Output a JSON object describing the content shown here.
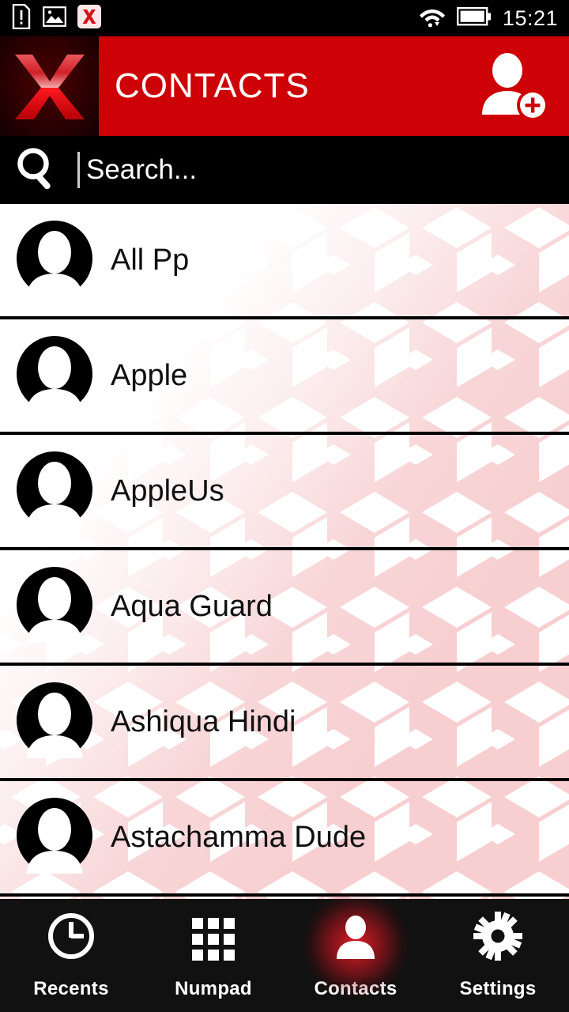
{
  "statusbar": {
    "icons": [
      {
        "name": "alert-document-icon",
        "glyph": "alert-doc"
      },
      {
        "name": "image-icon",
        "glyph": "picture"
      },
      {
        "name": "app-x-icon",
        "glyph": "x-app"
      }
    ],
    "wifi_icon": "wifi-icon",
    "battery_icon": "battery-full-icon",
    "time": "15:21"
  },
  "header": {
    "logo": "app-logo-x",
    "title": "CONTACTS",
    "add_contact_icon": "add-contact-icon",
    "bg_color": "#CE0206",
    "logo_bg_color": "#2D0002"
  },
  "search": {
    "icon": "search-icon",
    "placeholder": "Search...",
    "value": ""
  },
  "contacts": [
    {
      "name": "All Pp",
      "avatar": "contact-avatar"
    },
    {
      "name": "Apple",
      "avatar": "contact-avatar"
    },
    {
      "name": "AppleUs",
      "avatar": "contact-avatar"
    },
    {
      "name": "Aqua Guard",
      "avatar": "contact-avatar"
    },
    {
      "name": "Ashiqua Hindi",
      "avatar": "contact-avatar"
    },
    {
      "name": "Astachamma Dude",
      "avatar": "contact-avatar"
    }
  ],
  "watermark": {
    "pattern": "isometric-cubes",
    "color": "#F7CFD1"
  },
  "navbar": {
    "items": [
      {
        "label": "Recents",
        "icon": "clock-icon",
        "active": false
      },
      {
        "label": "Numpad",
        "icon": "grid-keypad-icon",
        "active": false
      },
      {
        "label": "Contacts",
        "icon": "person-icon",
        "active": true
      },
      {
        "label": "Settings",
        "icon": "gear-icon",
        "active": false
      }
    ],
    "active_glow_color": "#E61E28",
    "bg_color": "#111111"
  }
}
